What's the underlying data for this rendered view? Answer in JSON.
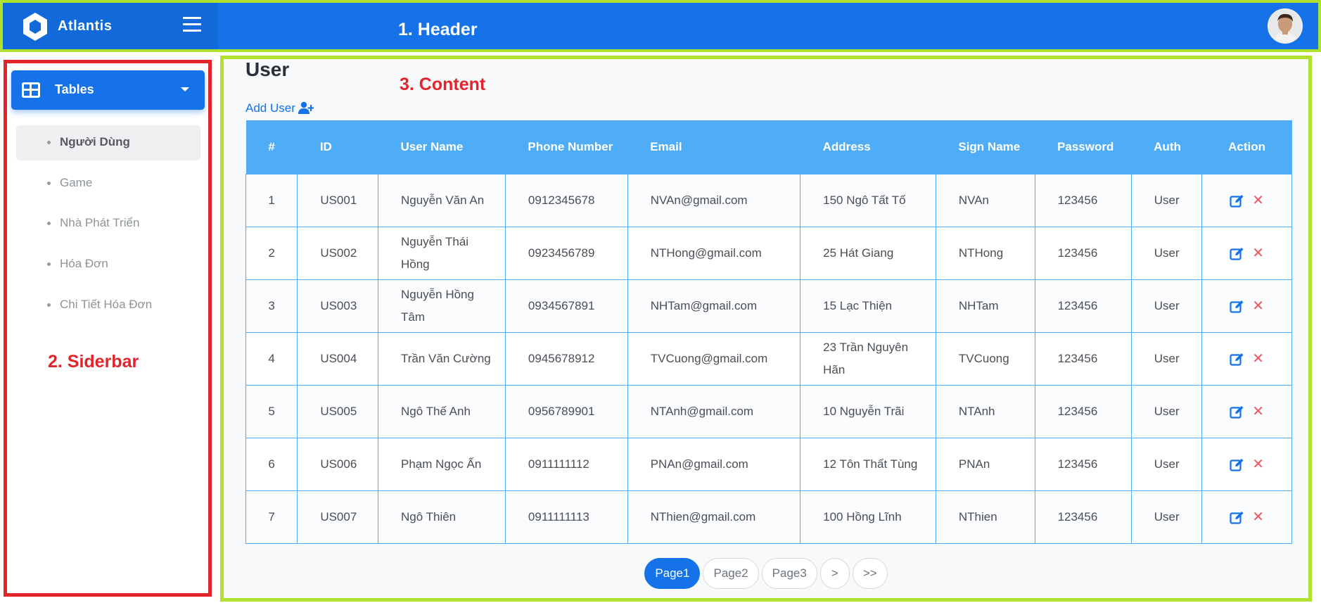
{
  "header": {
    "brand": "Atlantis",
    "annotation": "1. Header"
  },
  "sidebar": {
    "group_label": "Tables",
    "items": [
      {
        "label": "Người Dùng",
        "active": true
      },
      {
        "label": "Game",
        "active": false
      },
      {
        "label": "Nhà Phát Triển",
        "active": false
      },
      {
        "label": "Hóa Đơn",
        "active": false
      },
      {
        "label": "Chi Tiết Hóa Đơn",
        "active": false
      }
    ],
    "annotation": "2. Siderbar"
  },
  "content": {
    "title": "User",
    "annotation": "3. Content",
    "add_user": "Add User",
    "columns": [
      "#",
      "ID",
      "User Name",
      "Phone Number",
      "Email",
      "Address",
      "Sign Name",
      "Password",
      "Auth",
      "Action"
    ],
    "rows": [
      [
        "1",
        "US001",
        "Nguyễn Văn An",
        "0912345678",
        "NVAn@gmail.com",
        "150 Ngô Tất Tố",
        "NVAn",
        "123456",
        "User"
      ],
      [
        "2",
        "US002",
        "Nguyễn Thái Hồng",
        "0923456789",
        "NTHong@gmail.com",
        "25 Hát Giang",
        "NTHong",
        "123456",
        "User"
      ],
      [
        "3",
        "US003",
        "Nguyễn Hồng Tâm",
        "0934567891",
        "NHTam@gmail.com",
        "15 Lạc Thiện",
        "NHTam",
        "123456",
        "User"
      ],
      [
        "4",
        "US004",
        "Trần Văn Cường",
        "0945678912",
        "TVCuong@gmail.com",
        "23 Trần Nguyên Hãn",
        "TVCuong",
        "123456",
        "User"
      ],
      [
        "5",
        "US005",
        "Ngô Thế Anh",
        "0956789901",
        "NTAnh@gmail.com",
        "10 Nguyễn Trãi",
        "NTAnh",
        "123456",
        "User"
      ],
      [
        "6",
        "US006",
        "Phạm Ngọc Ấn",
        "0911111112",
        "PNAn@gmail.com",
        "12 Tôn Thất Tùng",
        "PNAn",
        "123456",
        "User"
      ],
      [
        "7",
        "US007",
        "Ngô Thiên",
        "0911111113",
        "NThien@gmail.com",
        "100 Hồng Lĩnh",
        "NThien",
        "123456",
        "User"
      ]
    ],
    "pagination": [
      {
        "label": "Page1",
        "active": true
      },
      {
        "label": "Page2",
        "active": false
      },
      {
        "label": "Page3",
        "active": false
      },
      {
        "label": ">",
        "active": false
      },
      {
        "label": ">>",
        "active": false
      }
    ],
    "icons": {
      "edit": "edit-icon",
      "delete": "close-icon",
      "add_user": "user-plus-icon"
    },
    "colors": {
      "primary": "#1572e8",
      "table_header": "#4facf7",
      "delete": "#f3545d",
      "annotation_red": "#e3242b",
      "annotation_green": "#aee22d"
    }
  }
}
